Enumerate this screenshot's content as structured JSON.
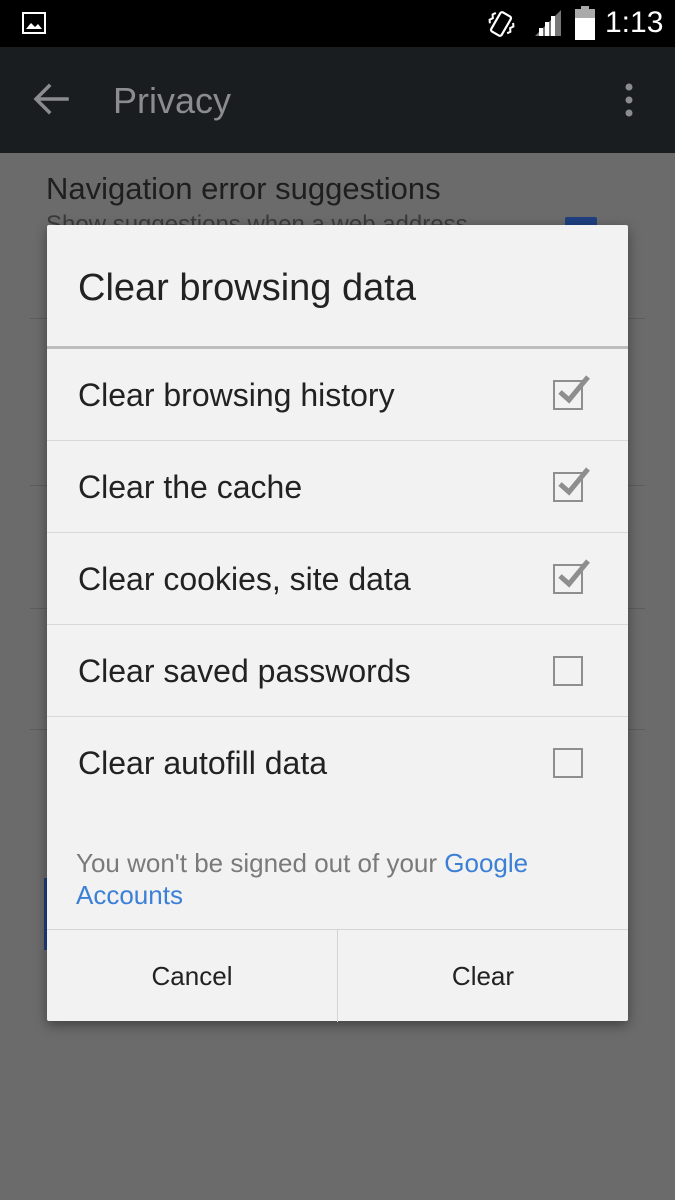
{
  "status_bar": {
    "time": "1:13",
    "icons": [
      "gallery-icon",
      "vibrate-icon",
      "signal-icon",
      "battery-icon"
    ]
  },
  "app_bar": {
    "title": "Privacy",
    "back_icon": "arrow-back-icon",
    "menu_icon": "more-vert-icon"
  },
  "background": {
    "pref_title": "Navigation error suggestions",
    "pref_subtitle": "Show suggestions when a web address"
  },
  "dialog": {
    "title": "Clear browsing data",
    "options": [
      {
        "label": "Clear browsing history",
        "checked": true
      },
      {
        "label": "Clear the cache",
        "checked": true
      },
      {
        "label": "Clear cookies, site data",
        "checked": true
      },
      {
        "label": "Clear saved passwords",
        "checked": false
      },
      {
        "label": "Clear autofill data",
        "checked": false
      }
    ],
    "note_text": "You won't be signed out of your ",
    "note_link": "Google Accounts",
    "cancel_label": "Cancel",
    "clear_label": "Clear"
  },
  "colors": {
    "link": "#3c80d6",
    "check": "#8e8e8e",
    "dialog_bg": "#f2f2f2",
    "scrim": "#6b6b6b"
  }
}
